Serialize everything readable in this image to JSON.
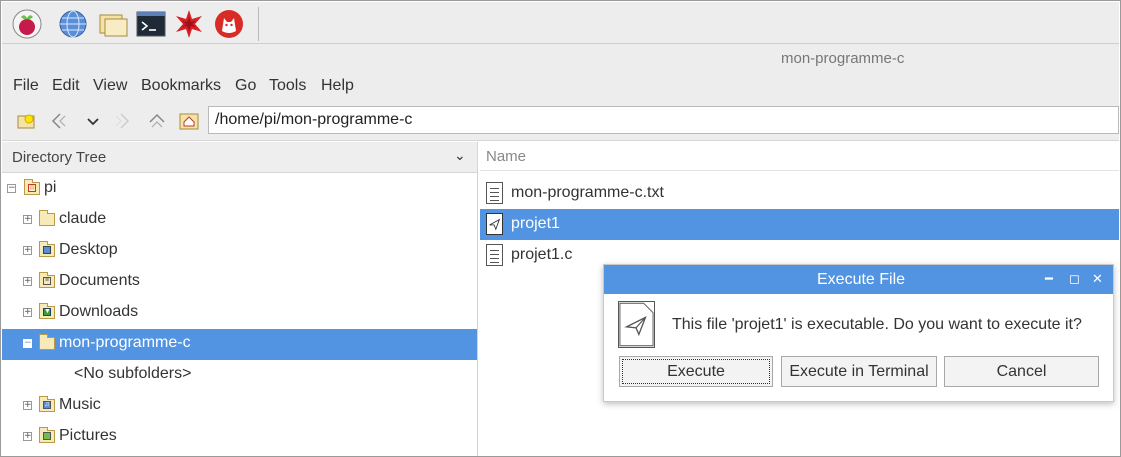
{
  "window": {
    "title": "mon-programme-c"
  },
  "taskbar": {
    "icons": [
      "raspberry-menu-icon",
      "web-browser-icon",
      "file-manager-icon",
      "terminal-icon",
      "mathematica-icon",
      "wolfram-icon"
    ]
  },
  "menubar": {
    "items": [
      "File",
      "Edit",
      "View",
      "Bookmarks",
      "Go",
      "Tools",
      "Help"
    ]
  },
  "toolbar": {
    "path": "/home/pi/mon-programme-c"
  },
  "sidebar": {
    "header": "Directory Tree",
    "items": [
      {
        "label": "pi",
        "icon": "home-folder-icon",
        "expanded": true
      },
      {
        "label": "claude",
        "icon": "folder-icon"
      },
      {
        "label": "Desktop",
        "icon": "desktop-folder-icon"
      },
      {
        "label": "Documents",
        "icon": "documents-folder-icon"
      },
      {
        "label": "Downloads",
        "icon": "downloads-folder-icon"
      },
      {
        "label": "mon-programme-c",
        "icon": "folder-icon",
        "selected": true
      },
      {
        "label": "<No subfolders>"
      },
      {
        "label": "Music",
        "icon": "music-folder-icon"
      },
      {
        "label": "Pictures",
        "icon": "pictures-folder-icon"
      }
    ]
  },
  "files": {
    "column_name": "Name",
    "items": [
      {
        "name": "mon-programme-c.txt",
        "icon": "text-file-icon"
      },
      {
        "name": "projet1",
        "icon": "executable-file-icon",
        "selected": true
      },
      {
        "name": "projet1.c",
        "icon": "text-file-icon"
      }
    ]
  },
  "dialog": {
    "title": "Execute File",
    "message": "This file 'projet1' is executable. Do you want to execute it?",
    "buttons": {
      "execute": "Execute",
      "execute_terminal": "Execute in Terminal",
      "cancel": "Cancel"
    }
  },
  "colors": {
    "selection": "#5294e2",
    "raspberry": "#c51a4a"
  }
}
